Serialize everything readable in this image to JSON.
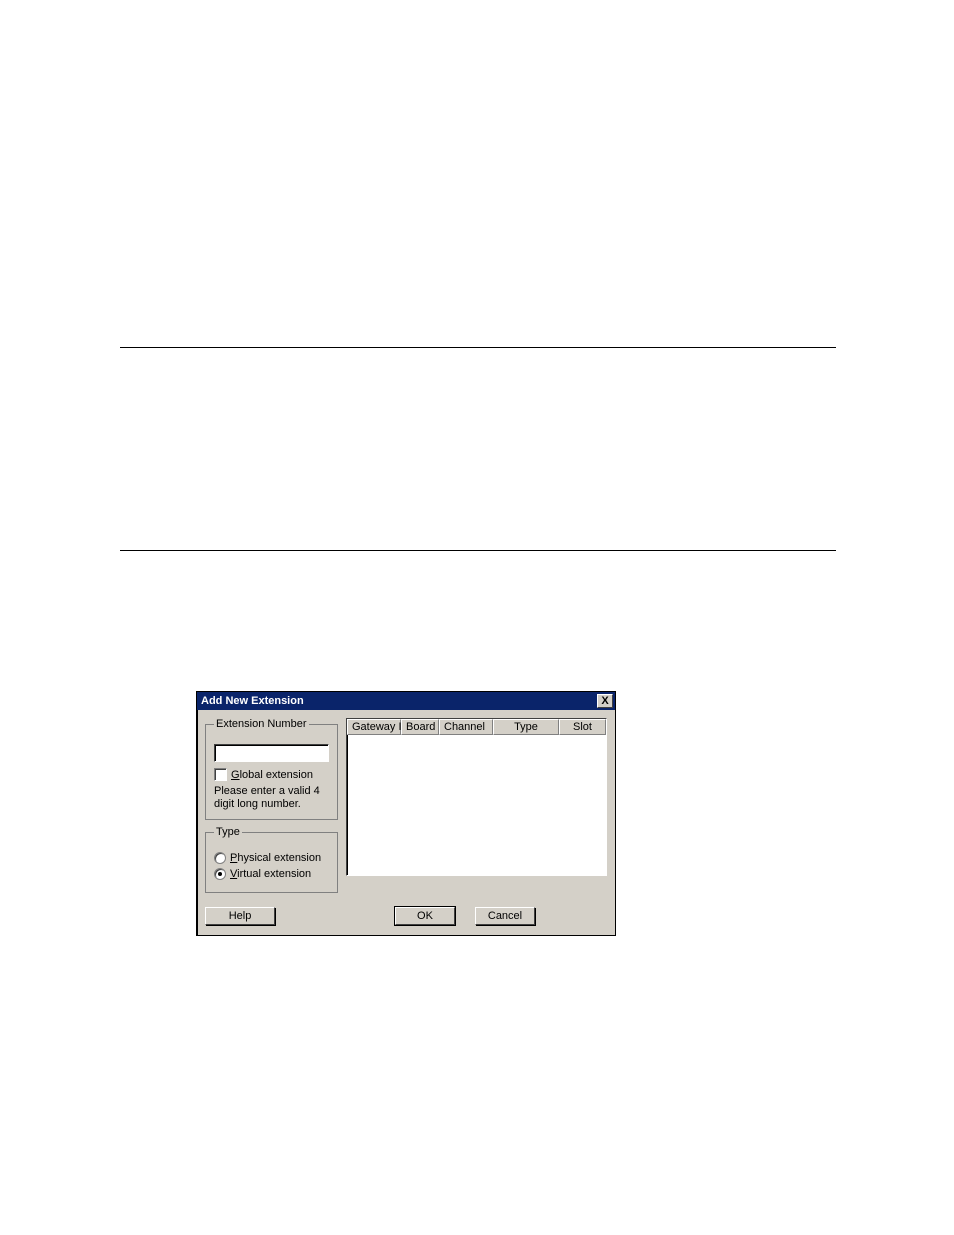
{
  "rules": {},
  "dialog": {
    "title": "Add New Extension",
    "close_label": "X",
    "ext_group_legend": "Extension Number",
    "ext_input_value": "",
    "global_ext_label_prefix": "G",
    "global_ext_label_rest": "lobal extension",
    "global_ext_checked": false,
    "ext_help_text": "Please enter a valid 4 digit long number.",
    "type_group_legend": "Type",
    "physical_label_prefix": "P",
    "physical_label_rest": "hysical extension",
    "virtual_label_prefix": "V",
    "virtual_label_rest": "irtual extension",
    "type_selected": "virtual",
    "grid_headers": {
      "gateway": "Gateway Id",
      "board": "Board",
      "channel": "Channel",
      "type": "Type",
      "slot": "Slot"
    },
    "buttons": {
      "help": "Help",
      "ok": "OK",
      "cancel": "Cancel"
    }
  }
}
